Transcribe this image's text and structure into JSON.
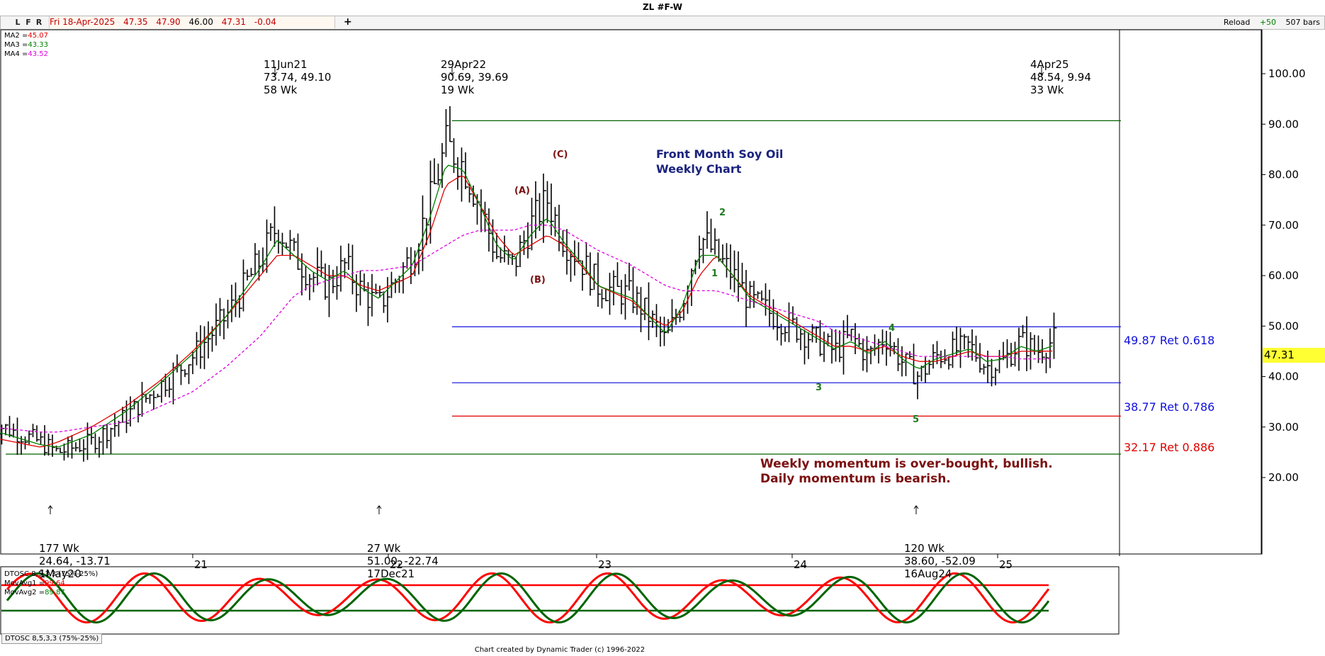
{
  "window": {
    "title": "ZL #F-W"
  },
  "toolbar": {
    "buttons": [
      "L",
      "F",
      "R"
    ],
    "quote": {
      "date": "Fri 18-Apr-2025",
      "open": "47.35",
      "high": "47.90",
      "low": "46.00",
      "close": "47.31",
      "change": "-0.04"
    },
    "plus": "+",
    "reload": "Reload",
    "reload_step": "+50",
    "bars": "507 bars"
  },
  "colors": {
    "ma2": "#e00000",
    "ma3": "#008000",
    "ma4": "#e000e0",
    "bars": "#000000",
    "retrace_blue": "#1010e0",
    "retrace_red": "#e00000",
    "green_line": "#006400",
    "highlight": "#ffff33",
    "osc_red": "#ff0000",
    "osc_green": "#006400"
  },
  "ma_legend": [
    {
      "label": "MA2 =",
      "value": "45.07",
      "color": "#e00000"
    },
    {
      "label": "MA3 =",
      "value": "43.33",
      "color": "#008000"
    },
    {
      "label": "MA4 =",
      "value": "43.52",
      "color": "#e000e0"
    }
  ],
  "annotations": {
    "peak1": {
      "date": "11Jun21",
      "values": "73.74, 49.10",
      "weeks": "58 Wk"
    },
    "peak2": {
      "date": "29Apr22",
      "values": "90.69, 39.69",
      "weeks": "19 Wk"
    },
    "peak3": {
      "date": "4Apr25",
      "values": "48.54, 9.94",
      "weeks": "33 Wk"
    },
    "low1": {
      "weeks": "177 Wk",
      "values": "24.64, -13.71",
      "date": "1May20"
    },
    "low2": {
      "weeks": "27 Wk",
      "values": "51.00, -22.74",
      "date": "17Dec21"
    },
    "low3": {
      "weeks": "120 Wk",
      "values": "38.60, -52.09",
      "date": "16Aug24"
    }
  },
  "chart_title": {
    "line1": "Front Month Soy Oil",
    "line2": "Weekly Chart"
  },
  "retracements": [
    {
      "price": 49.87,
      "label": "49.87 Ret 0.618",
      "color": "#1010e0"
    },
    {
      "price": 38.77,
      "label": "38.77 Ret 0.786",
      "color": "#1010e0"
    },
    {
      "price": 32.17,
      "label": "32.17 Ret 0.886",
      "color": "#e00000"
    }
  ],
  "commentary": {
    "line1": "Weekly momentum is over-bought, bullish.",
    "line2": "Daily momentum is bearish."
  },
  "waves_abc": [
    "(A)",
    "(B)",
    "(C)"
  ],
  "waves_num": [
    "1",
    "2",
    "3",
    "4",
    "5"
  ],
  "last_price": "47.31",
  "oscillator": {
    "name": "DTOSC 8,5,3,3 (75%-25%)",
    "mov1_label": "MovAvg1 =",
    "mov1_value": "99.64",
    "mov2_label": "MovAvg2 =",
    "mov2_value": "89.87",
    "tab": "DTOSC 8,5,3,3 (75%-25%)"
  },
  "footer": "Chart created by Dynamic Trader  (c) 1996-2022",
  "chart_data": {
    "type": "line",
    "title": "Front Month Soy Oil Weekly Chart",
    "ylim": [
      15,
      102
    ],
    "y_ticks": [
      "20.00",
      "30.00",
      "40.00",
      "50.00",
      "60.00",
      "70.00",
      "80.00",
      "90.00",
      "100.00"
    ],
    "x_ticks": [
      "21",
      "22",
      "23",
      "24",
      "25"
    ],
    "series": [
      {
        "name": "Close",
        "x": [
          "2020-01",
          "2020-04",
          "2020-05",
          "2020-07",
          "2020-09",
          "2020-11",
          "2021-01",
          "2021-03",
          "2021-05",
          "2021-06",
          "2021-07",
          "2021-08",
          "2021-09",
          "2021-10",
          "2021-11",
          "2021-12",
          "2022-02",
          "2022-03",
          "2022-04",
          "2022-05",
          "2022-06",
          "2022-07",
          "2022-08",
          "2022-09",
          "2022-10",
          "2022-11",
          "2022-12",
          "2023-01",
          "2023-03",
          "2023-04",
          "2023-05",
          "2023-06",
          "2023-07",
          "2023-08",
          "2023-09",
          "2023-10",
          "2023-12",
          "2024-02",
          "2024-03",
          "2024-04",
          "2024-05",
          "2024-06",
          "2024-07",
          "2024-08",
          "2024-09",
          "2024-10",
          "2024-11",
          "2024-12",
          "2025-01",
          "2025-02",
          "2025-03",
          "2025-04"
        ],
        "values": [
          31,
          27,
          25,
          27,
          32,
          38,
          44,
          52,
          63,
          70,
          64,
          60,
          58,
          62,
          57,
          54,
          64,
          74,
          86,
          82,
          74,
          64,
          62,
          70,
          75,
          67,
          63,
          58,
          56,
          52,
          47,
          55,
          68,
          64,
          60,
          55,
          51,
          47,
          45,
          48,
          44,
          48,
          43,
          40,
          44,
          45,
          46,
          42,
          43,
          47,
          45,
          47.31
        ]
      },
      {
        "name": "MA2",
        "values": [
          28,
          26,
          27,
          30,
          34,
          39,
          45,
          52,
          60,
          64,
          64,
          62,
          60,
          60,
          58,
          57,
          60,
          68,
          78,
          80,
          74,
          68,
          64,
          66,
          68,
          66,
          62,
          58,
          55,
          52,
          50,
          53,
          60,
          64,
          60,
          56,
          52,
          48,
          46,
          46,
          45,
          46,
          44,
          43,
          43,
          44,
          45,
          44,
          44,
          45,
          45,
          45.07
        ]
      },
      {
        "name": "MA4",
        "values": [
          30,
          29,
          29,
          30,
          31,
          34,
          37,
          42,
          48,
          52,
          56,
          58,
          59,
          60,
          61,
          61,
          62,
          64,
          66,
          68,
          69,
          69,
          69,
          70,
          70,
          69,
          67,
          65,
          62,
          60,
          58,
          57,
          57,
          57,
          56,
          55,
          53,
          51,
          49,
          48,
          47,
          46,
          45,
          44,
          44,
          44,
          44,
          44,
          44,
          43.5,
          43.5,
          43.52
        ]
      }
    ],
    "oscillator": {
      "levels": [
        75,
        25
      ]
    }
  }
}
